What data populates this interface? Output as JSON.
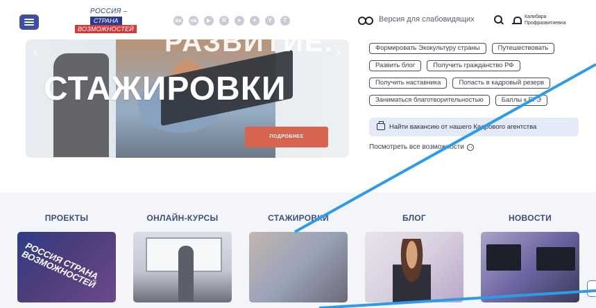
{
  "header": {
    "menu_icon": "hamburger-icon",
    "logo": {
      "line1": "РОССИЯ –",
      "line2": "СТРАНА",
      "line3": "ВОЗМОЖНОСТЕЙ"
    },
    "socials": [
      "vk-icon",
      "ok-icon",
      "youtube-icon",
      "rutube-icon",
      "telegram-icon",
      "dzen-icon",
      "yappy-icon",
      "tenchat-icon"
    ],
    "vision_label": "Версия для слабовидящих",
    "user_name_line1": "Калибара",
    "user_name_line2": "Профразвитиевна"
  },
  "slider": {
    "top_text": "РАЗВИТИЕ.",
    "title": "СТАЖИРОВКИ",
    "button_label": "ПОДРОБНЕЕ",
    "prev_icon": "chevron-left-icon",
    "next_icon": "chevron-right-icon"
  },
  "tags": [
    [
      "Формировать Экокультуру страны",
      "Путешествовать"
    ],
    [
      "Развить блог",
      "Получить гражданство РФ"
    ],
    [
      "Получить наставника",
      "Попасть в кадровый резерв"
    ],
    [
      "Заниматься благотворительностью",
      "Баллы к ЕГЭ"
    ]
  ],
  "vacancy_label": "Найти вакансию от нашего Кадрового агентства",
  "view_all_label": "Посмотреть все возможности",
  "sections": [
    {
      "title": "ПРОЕКТЫ",
      "stamp": "РОССИЯ СТРАНА ВОЗМОЖНОСТЕЙ"
    },
    {
      "title": "ОНЛАЙН-КУРСЫ"
    },
    {
      "title": "СТАЖИРОВКИ"
    },
    {
      "title": "БЛОГ"
    },
    {
      "title": "НОВОСТИ"
    }
  ],
  "colors": {
    "brand_blue": "#3d4f9e",
    "accent_red": "#d6644f",
    "section_bg": "#f3f5f8",
    "pointer_line": "#2f9be8"
  }
}
